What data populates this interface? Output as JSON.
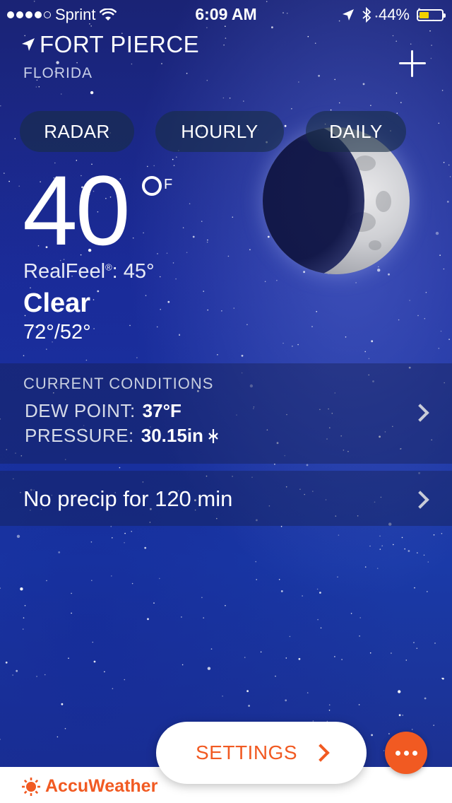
{
  "status_bar": {
    "carrier": "Sprint",
    "time": "6:09 AM",
    "battery_percent": "44%",
    "battery_level": 0.44,
    "battery_color": "#f2d100",
    "signal_bars": 4
  },
  "location": {
    "city": "FORT PIERCE",
    "state": "FLORIDA",
    "icon": "location-arrow-icon"
  },
  "tabs": [
    {
      "label": "RADAR"
    },
    {
      "label": "HOURLY"
    },
    {
      "label": "DAILY"
    }
  ],
  "current": {
    "temperature": "40",
    "unit": "F",
    "realfeel_label": "RealFeel",
    "realfeel_mark": "®",
    "realfeel_value": ": 45°",
    "condition": "Clear",
    "hi_lo": "72°/52°",
    "icon": "moon-icon"
  },
  "conditions": {
    "title": "CURRENT CONDITIONS",
    "dew_point_label": "DEW POINT:",
    "dew_point_value": "37°F",
    "pressure_label": "PRESSURE:",
    "pressure_value": "30.15in",
    "pressure_trend_icon": "steady-icon"
  },
  "precip": {
    "text": "No precip for 120 min"
  },
  "footer": {
    "brand": "AccuWeather",
    "brand_color": "#f15a22",
    "settings_label": "SETTINGS",
    "more_icon": "more-dots-icon"
  }
}
